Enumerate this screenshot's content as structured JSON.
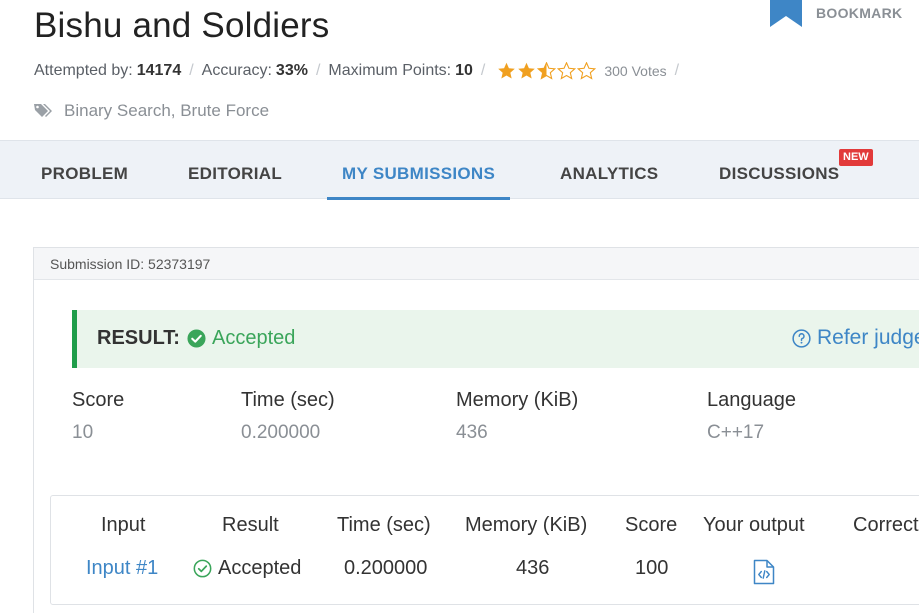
{
  "problem": {
    "title": "Bishu and Soldiers"
  },
  "bookmark": {
    "label": "BOOKMARK",
    "icon": "bookmark-icon"
  },
  "meta": {
    "attempted_label": "Attempted by:",
    "attempted_value": "14174",
    "accuracy_label": "Accuracy:",
    "accuracy_value": "33%",
    "points_label": "Maximum Points:",
    "points_value": "10",
    "separator": "/",
    "rating": 2.5,
    "rating_max": 5,
    "votes": "300 Votes"
  },
  "tags": {
    "icon": "tags-icon",
    "text": "Binary Search, Brute Force"
  },
  "tabs": [
    {
      "label": "PROBLEM"
    },
    {
      "label": "EDITORIAL"
    },
    {
      "label": "MY SUBMISSIONS"
    },
    {
      "label": "ANALYTICS"
    },
    {
      "label": "DISCUSSIONS"
    }
  ],
  "new_badge": "NEW",
  "submission": {
    "id_text": "Submission ID: 52373197",
    "result_label": "RESULT:",
    "result_status": "Accepted",
    "refer_link": "Refer judge",
    "stats": [
      {
        "header": "Score",
        "value": "10"
      },
      {
        "header": "Time (sec)",
        "value": "0.200000"
      },
      {
        "header": "Memory (KiB)",
        "value": "436"
      },
      {
        "header": "Language",
        "value": "C++17"
      }
    ]
  },
  "testcases": {
    "headers": [
      "Input",
      "Result",
      "Time (sec)",
      "Memory (KiB)",
      "Score",
      "Your output",
      "Correct"
    ],
    "rows": [
      {
        "input": "Input #1",
        "result": "Accepted",
        "time": "0.200000",
        "memory": "436",
        "score": "100"
      }
    ]
  },
  "colors": {
    "accent": "#3e86c6",
    "success": "#3aa55a",
    "star": "#f0a020",
    "badge": "#e23a3a"
  }
}
